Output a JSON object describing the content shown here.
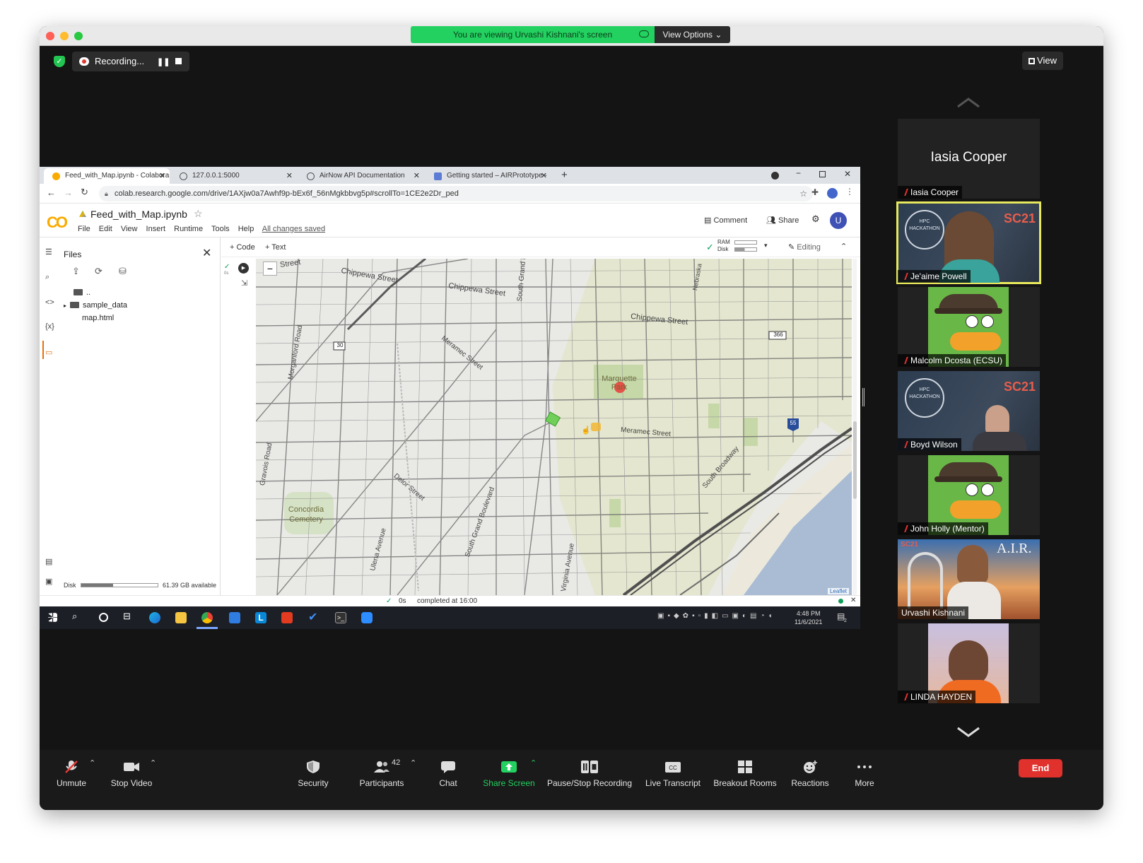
{
  "zoom": {
    "banner_text": "You are viewing Urvashi Kishnani's screen",
    "view_options": "View Options",
    "recording_label": "Recording...",
    "view_button": "View",
    "toolbar": {
      "unmute": "Unmute",
      "stop_video": "Stop Video",
      "security": "Security",
      "participants": "Participants",
      "participants_count": "42",
      "chat": "Chat",
      "share_screen": "Share Screen",
      "pause_stop_recording": "Pause/Stop Recording",
      "live_transcript": "Live Transcript",
      "breakout_rooms": "Breakout Rooms",
      "reactions": "Reactions",
      "more": "More",
      "end": "End"
    },
    "participants": [
      {
        "name": "Iasia Cooper",
        "big_name": "Iasia Cooper",
        "kind": "name-only"
      },
      {
        "name": "Je'aime Powell",
        "kind": "hackathon",
        "active": true
      },
      {
        "name": "Malcolm Dcosta (ECSU)",
        "kind": "perry"
      },
      {
        "name": "Boyd Wilson",
        "kind": "hackathon"
      },
      {
        "name": "John Holly (Mentor)",
        "kind": "perry"
      },
      {
        "name": "Urvashi Kishnani",
        "kind": "air"
      },
      {
        "name": "LINDA HAYDEN",
        "kind": "linda"
      }
    ],
    "tile_texts": {
      "sc21": "SC21",
      "hpc_city": "HPC",
      "hackathon": "HACKATHON",
      "air": "A.I.R."
    }
  },
  "browser": {
    "tabs": [
      {
        "label": "Feed_with_Map.ipynb - Colabora"
      },
      {
        "label": "127.0.0.1:5000"
      },
      {
        "label": "AirNow API Documentation"
      },
      {
        "label": "Getting started – AIRPrototype -"
      }
    ],
    "url": "colab.research.google.com/drive/1AXjw0a7Awhf9p-bEx6f_56nMgkbbvg5p#scrollTo=1CE2e2Dr_ped"
  },
  "colab": {
    "logo": "CO",
    "notebook_name": "Feed_with_Map.ipynb",
    "menu": [
      "File",
      "Edit",
      "View",
      "Insert",
      "Runtime",
      "Tools",
      "Help"
    ],
    "saved_status": "All changes saved",
    "comment": "Comment",
    "share": "Share",
    "user_initial": "U",
    "files_title": "Files",
    "files": {
      "parent": "..",
      "folder": "sample_data",
      "file": "map.html"
    },
    "disk_label": "Disk",
    "disk_available": "61.39 GB available",
    "disk_used_fraction": 0.42,
    "add_code": "+ Code",
    "add_text": "+ Text",
    "ram_label": "RAM",
    "disk_short": "Disk",
    "editing": "Editing",
    "cell_time": "0s",
    "status_time": "0s",
    "status_text": "completed at 16:00",
    "map": {
      "labels": {
        "street1": "Street",
        "chippewa1": "Chippewa   Street",
        "chippewa2": "Chippewa   Street",
        "chippewa3": "Chippewa   Street",
        "meramec1": "Meramec   Street",
        "meramec2": "Meramec   Street",
        "marquette": "Marquette Park",
        "concordia": "Concordia Cemetery",
        "s_grand": "South   Grand   Boule",
        "s_grand_blvd": "South   Grand   Boulevard",
        "s_broadway": "South   Broadway",
        "nebraska": "Nebraska",
        "morganford": "Morganford   Road",
        "gravois": "Gravois   Road",
        "delor": "Delor   Street",
        "virginia": "Virginia   Avenue",
        "ulena": "Ulena   Avenue",
        "route30": "30",
        "route366": "366",
        "route55": "55",
        "attribution": "Leaflet",
        "zoom_out": "−"
      }
    }
  },
  "taskbar": {
    "time": "4:48 PM",
    "date": "11/6/2021",
    "notif_count": "2"
  }
}
